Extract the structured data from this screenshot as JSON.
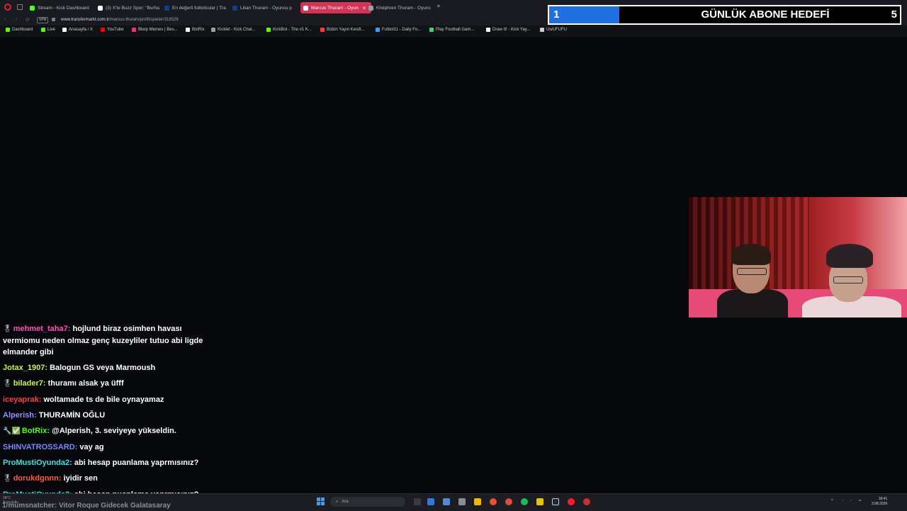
{
  "browser": {
    "tabs": [
      {
        "label": "Stream - Kick Dashboard",
        "color": "#53fc18"
      },
      {
        "label": "(3) X'te Buzz Spor: \"Burha",
        "color": "#ffffff"
      },
      {
        "label": "En değerli futbolcular | Tra",
        "color": "#1a3c8f"
      },
      {
        "label": "Lilian Thuram - Oyuncu p",
        "color": "#1a3c8f"
      },
      {
        "label": "Marcus Thuram - Oyun",
        "color": "#ffffff",
        "active": true
      },
      {
        "label": "Khéphren Thuram - Oyunc",
        "color": "#9aa0aa"
      }
    ],
    "close_tab": "×",
    "new_tab": "+",
    "vpn_label": "VPN",
    "url_host": "www.transfermarkt.com.tr",
    "url_path": "/marcus-thuram/profil/spieler/318528",
    "bookmarks": [
      {
        "label": "Dashboard",
        "color": "#53fc18"
      },
      {
        "label": "Live",
        "color": "#53fc18"
      },
      {
        "label": "Anasayfa / X",
        "color": "#ffffff"
      },
      {
        "label": "YouTube",
        "color": "#ff0000"
      },
      {
        "label": "Blerp Memes | Bes...",
        "color": "#ff2d6f"
      },
      {
        "label": "BotRix",
        "color": "#ffffff"
      },
      {
        "label": "Kicklet - Kick Chat...",
        "color": "#9aa0aa"
      },
      {
        "label": "KickBot - The #1 K...",
        "color": "#53fc18"
      },
      {
        "label": "Bütün Yayın Kesitl...",
        "color": "#ff3b3b"
      },
      {
        "label": "Futbol11 - Daily Fo...",
        "color": "#3aa0ff"
      },
      {
        "label": "Play Football Gam...",
        "color": "#3fd17a"
      },
      {
        "label": "Draw It! - Kick Yay...",
        "color": "#ffffff"
      },
      {
        "label": "UwUFUFU",
        "color": "#c9ccd3"
      }
    ]
  },
  "goal": {
    "current": "1",
    "title": "GÜNLÜK ABONE HEDEFİ",
    "target": "5",
    "progress": 0.2,
    "fill_color": "#1f6fe0"
  },
  "chat": {
    "messages": [
      {
        "icon": "🎖",
        "user": "mehmet_taha7",
        "user_color": "#ff4fb8",
        "text": "hojlund biraz osimhen havası vermiomu neden olmaz genç kuzeyliler tutuo abi ligde elmander gibi"
      },
      {
        "icon": "",
        "user": "Jotax_1907",
        "user_color": "#c7f34a",
        "text": "Balogun GS veya Marmoush"
      },
      {
        "icon": "🎖",
        "user": "bilader7",
        "user_color": "#c7f34a",
        "text": "thuramı alsak ya üfff"
      },
      {
        "icon": "",
        "user": "iceyaprak",
        "user_color": "#ff3b3b",
        "text": "woltamade ts de bile oynayamaz"
      },
      {
        "icon": "",
        "user": "Alperish",
        "user_color": "#9d8cff",
        "text": "THURAMİN OĞLU"
      },
      {
        "icon": "🔧✅",
        "user": "BotRix",
        "user_color": "#53fc18",
        "text": "@Alperish, 3. seviyeye yükseldin."
      },
      {
        "icon": "",
        "user": "SHINVATROSSARD",
        "user_color": "#7a86ff",
        "text": "vay ag"
      },
      {
        "icon": "",
        "user": "ProMustiOyunda2",
        "user_color": "#3fe0e0",
        "text": "abi hesap puanlama yaprmısınız?"
      },
      {
        "icon": "🎖",
        "user": "dorukdgnnn",
        "user_color": "#ff5a3b",
        "text": "iyidir sen"
      },
      {
        "icon": "",
        "user": "ProMustiOyunda2",
        "user_color": "#3fe0e0",
        "text": "abi hesap puanlama yaprmısınız?"
      }
    ]
  },
  "ticker": "1/mumsnatcher: Vitor Roque Gidecek Galatasaray",
  "taskbar": {
    "weather_temp": "28°C",
    "weather_desc": "Az bulutlu",
    "search_placeholder": "Ara",
    "time": "18:41",
    "date": "3.08.2026"
  }
}
